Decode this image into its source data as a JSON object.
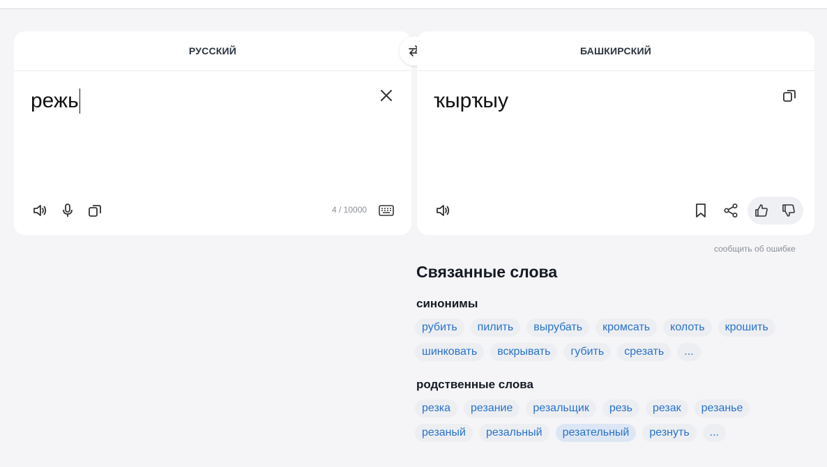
{
  "source": {
    "language": "РУССКИЙ",
    "text": "режь",
    "counter": "4 / 10000"
  },
  "target": {
    "language": "БАШКИРСКИЙ",
    "text": "ҡырҡыу"
  },
  "report_error": "сообщить об ошибке",
  "related": {
    "title": "Связанные слова",
    "synonyms_title": "синонимы",
    "synonyms": [
      "рубить",
      "пилить",
      "вырубать",
      "кромсать",
      "колоть",
      "крошить",
      "шинковать",
      "вскрывать",
      "губить",
      "срезать",
      "..."
    ],
    "cognates_title": "родственные слова",
    "cognates": [
      "резка",
      "резание",
      "резальщик",
      "резь",
      "резак",
      "резанье",
      "резаный",
      "резальный",
      "резательный",
      "резнуть",
      "..."
    ]
  },
  "icons": {
    "swap": "swap-arrows-icon",
    "clear": "close-icon",
    "speaker": "speaker-icon",
    "mic": "microphone-icon",
    "copy": "copy-icon",
    "keyboard": "keyboard-icon",
    "bookmark": "bookmark-icon",
    "share": "share-icon",
    "like": "thumbs-up-icon",
    "dislike": "thumbs-down-icon"
  },
  "colors": {
    "link": "#2a72c9",
    "chip_bg": "#eceef2",
    "background": "#f5f5f7"
  }
}
